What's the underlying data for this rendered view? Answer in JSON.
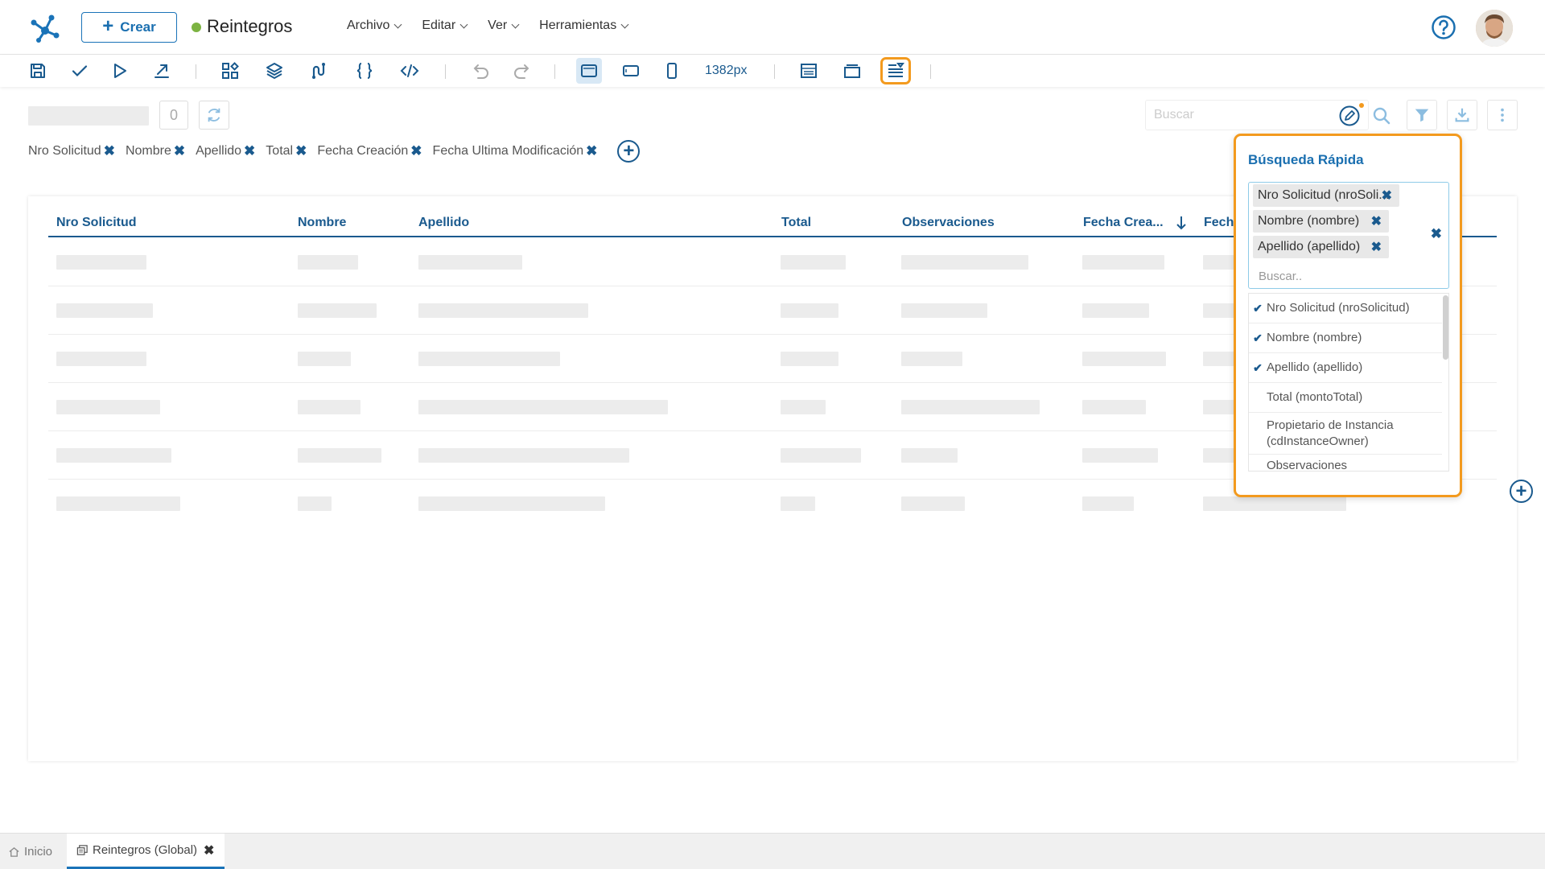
{
  "header": {
    "create_label": "Crear",
    "app_title": "Reintegros",
    "menu": [
      {
        "label": "Archivo"
      },
      {
        "label": "Editar"
      },
      {
        "label": "Ver"
      },
      {
        "label": "Herramientas"
      }
    ],
    "status_color": "#7cb342"
  },
  "toolbar": {
    "icons": [
      "save-icon",
      "check-icon",
      "play-icon",
      "export-icon",
      "widgets-icon",
      "layers-icon",
      "flow-icon",
      "braces-icon",
      "code-icon",
      "undo-icon",
      "redo-icon",
      "desktop-view-icon",
      "tablet-view-icon",
      "mobile-view-icon",
      "layout-icon",
      "panel-icon",
      "quick-search-config-icon"
    ],
    "width_readout": "1382px"
  },
  "content": {
    "count": "0",
    "search_placeholder": "Buscar",
    "chips": [
      {
        "label": "Nro Solicitud"
      },
      {
        "label": "Nombre"
      },
      {
        "label": "Apellido"
      },
      {
        "label": "Total"
      },
      {
        "label": "Fecha Creación"
      },
      {
        "label": "Fecha Ultima Modificación"
      }
    ]
  },
  "grid": {
    "columns": [
      {
        "label": "Nro Solicitud"
      },
      {
        "label": "Nombre"
      },
      {
        "label": "Apellido"
      },
      {
        "label": "Total"
      },
      {
        "label": "Observaciones"
      },
      {
        "label": "Fecha Crea..."
      },
      {
        "label": "Fech"
      }
    ],
    "row_count": 6
  },
  "quick_search": {
    "title": "Búsqueda Rápida",
    "selected": [
      {
        "label": "Nro Solicitud (nroSoli..."
      },
      {
        "label": "Nombre (nombre)"
      },
      {
        "label": "Apellido (apellido)"
      }
    ],
    "input_placeholder": "Buscar..",
    "options": [
      {
        "label": "Nro Solicitud (nroSolicitud)",
        "checked": true
      },
      {
        "label": "Nombre (nombre)",
        "checked": true
      },
      {
        "label": "Apellido (apellido)",
        "checked": true
      },
      {
        "label": "Total (montoTotal)",
        "checked": false
      },
      {
        "label": "Propietario de Instancia (cdInstanceOwner)",
        "checked": false
      },
      {
        "label": "Observaciones",
        "checked": false
      }
    ]
  },
  "tabs": {
    "home": "Inicio",
    "active": "Reintegros (Global)"
  },
  "colors": {
    "accent": "#1a5a8e",
    "highlight": "#f39a1e"
  }
}
